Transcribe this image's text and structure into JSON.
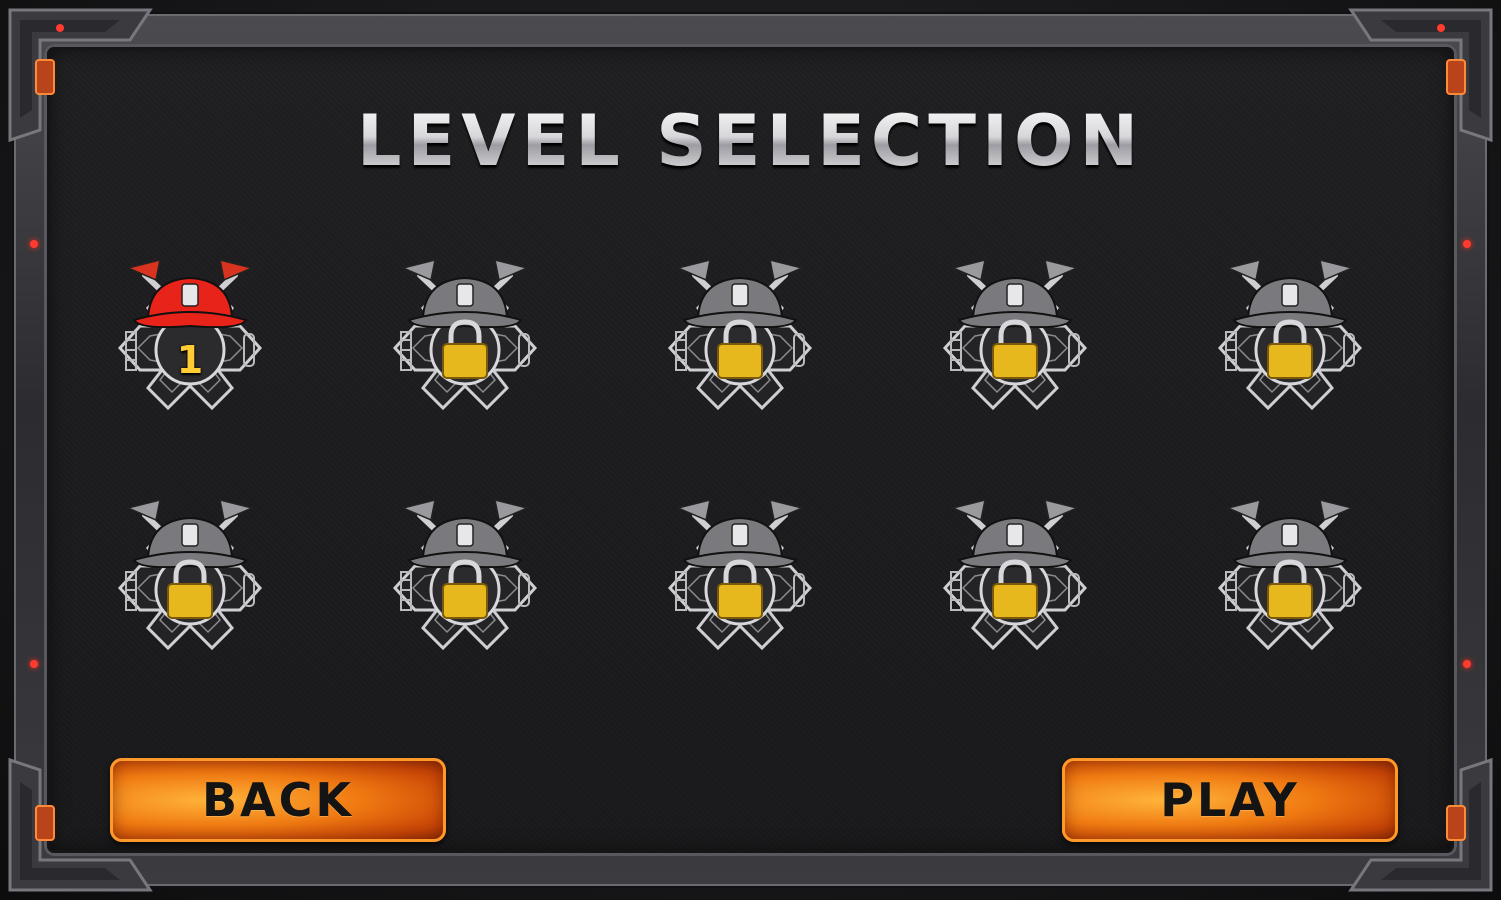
{
  "screen": {
    "title": "LEVEL SELECTION"
  },
  "levels": [
    {
      "label": "1",
      "state": "unlocked",
      "icon": "fire-helmet-badge-red-icon"
    },
    {
      "label": "",
      "state": "locked",
      "icon": "padlock-icon"
    },
    {
      "label": "",
      "state": "locked",
      "icon": "padlock-icon"
    },
    {
      "label": "",
      "state": "locked",
      "icon": "padlock-icon"
    },
    {
      "label": "",
      "state": "locked",
      "icon": "padlock-icon"
    },
    {
      "label": "",
      "state": "locked",
      "icon": "padlock-icon"
    },
    {
      "label": "",
      "state": "locked",
      "icon": "padlock-icon"
    },
    {
      "label": "",
      "state": "locked",
      "icon": "padlock-icon"
    },
    {
      "label": "",
      "state": "locked",
      "icon": "padlock-icon"
    },
    {
      "label": "",
      "state": "locked",
      "icon": "padlock-icon"
    }
  ],
  "buttons": {
    "back_label": "BACK",
    "play_label": "PLAY"
  },
  "colors": {
    "unlocked_helmet": "#e8231a",
    "locked_helmet": "#7a7a7e",
    "padlock": "#e7b81e",
    "button_orange": "#f07a12",
    "level_number": "#ffcc33"
  }
}
